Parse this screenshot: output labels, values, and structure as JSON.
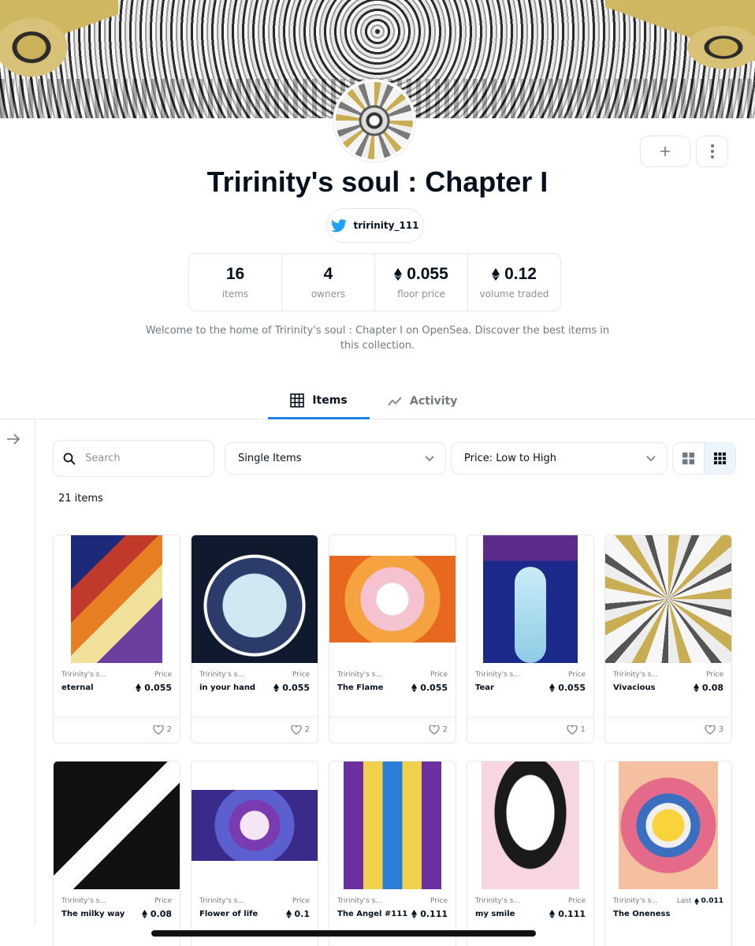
{
  "collection": {
    "title": "Tririnity's soul : Chapter I",
    "twitter_handle": "tririnity_111",
    "description": "Welcome to the home of Tririnity's soul : Chapter I on OpenSea. Discover the best items in this collection."
  },
  "stats": [
    {
      "value": "16",
      "label": "items",
      "eth": false
    },
    {
      "value": "4",
      "label": "owners",
      "eth": false
    },
    {
      "value": "0.055",
      "label": "floor price",
      "eth": true
    },
    {
      "value": "0.12",
      "label": "volume traded",
      "eth": true
    }
  ],
  "tabs": {
    "items": "Items",
    "activity": "Activity"
  },
  "filters": {
    "search_placeholder": "Search",
    "item_type": "Single Items",
    "sort": "Price: Low to High"
  },
  "results_count": "21 items",
  "cards": [
    {
      "collection": "Tririnity's s...",
      "name": "eternal",
      "price_label": "Price",
      "price": "0.055",
      "likes": "2"
    },
    {
      "collection": "Tririnity's s...",
      "name": "in your hand",
      "price_label": "Price",
      "price": "0.055",
      "likes": "2"
    },
    {
      "collection": "Tririnity's s...",
      "name": "The Flame",
      "price_label": "Price",
      "price": "0.055",
      "likes": "2"
    },
    {
      "collection": "Tririnity's s...",
      "name": "Tear",
      "price_label": "Price",
      "price": "0.055",
      "likes": "1"
    },
    {
      "collection": "Tririnity's s...",
      "name": "Vivacious",
      "price_label": "Price",
      "price": "0.08",
      "likes": "3"
    },
    {
      "collection": "Tririnity's s...",
      "name": "The milky way",
      "price_label": "Price",
      "price": "0.08"
    },
    {
      "collection": "Tririnity's s...",
      "name": "Flower of life",
      "price_label": "Price",
      "price": "0.1"
    },
    {
      "collection": "Tririnity's s...",
      "name": "The Angel #111",
      "price_label": "Price",
      "price": "0.111"
    },
    {
      "collection": "Tririnity's s...",
      "name": "my smile",
      "price_label": "Price",
      "price": "0.111"
    },
    {
      "collection": "Tririnity's s...",
      "name": "The Oneness",
      "last_label": "Last",
      "last_price": "0.011"
    }
  ],
  "colors": {
    "accent": "#2081e2",
    "text": "#04111d",
    "muted": "#707a83",
    "border": "#e5e8eb",
    "twitter": "#1da1f2"
  }
}
